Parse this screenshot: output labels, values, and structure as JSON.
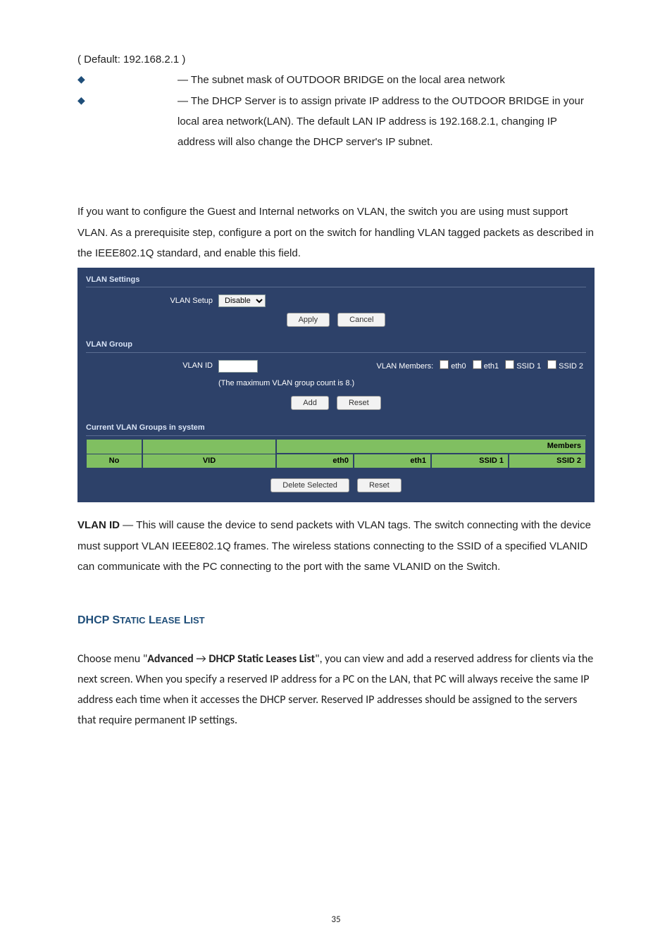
{
  "top": {
    "default_ip": "( Default: 192.168.2.1 )",
    "subnet_text": "— The subnet mask of OUTDOOR BRIDGE on the local area network",
    "dhcp_text": "— The DHCP Server is to assign private IP address to the OUTDOOR BRIDGE in your local area network(LAN). The default LAN IP address is 192.168.2.1, changing IP address will also change the DHCP server's IP subnet."
  },
  "intro": "If you want to configure the Guest and Internal networks on VLAN, the switch you are using must support VLAN. As a prerequisite step, configure a port on the switch for handling VLAN tagged packets as described in the IEEE802.1Q standard, and enable this field.",
  "panel": {
    "sec1": "VLAN Settings",
    "setup_lbl": "VLAN Setup",
    "setup_val": "Disable",
    "apply": "Apply",
    "cancel": "Cancel",
    "sec2": "VLAN Group",
    "vlan_id_lbl": "VLAN ID",
    "members_lbl": "VLAN Members:",
    "m_eth0": "eth0",
    "m_eth1": "eth1",
    "m_ssid1": "SSID 1",
    "m_ssid2": "SSID 2",
    "max_note": "(The maximum VLAN group count is 8.)",
    "add": "Add",
    "reset": "Reset",
    "sec3": "Current VLAN Groups in system",
    "col_no": "No",
    "col_vid": "VID",
    "col_members": "Members",
    "col_eth0": "eth0",
    "col_eth1": "eth1",
    "col_ssid1": "SSID 1",
    "col_ssid2": "SSID 2",
    "del_sel": "Delete Selected",
    "reset2": "Reset"
  },
  "vlan_id_para": {
    "label": "VLAN ID",
    "text": " — This will cause the device to send packets with VLAN tags. The switch connecting with the device must support VLAN IEEE802.1Q frames. The wireless stations connecting to the SSID of a specified VLANID can communicate with the PC connecting to the port with the same VLANID on the Switch."
  },
  "h2": {
    "big1": "DHCP S",
    "sm1": "TATIC",
    "big2": " L",
    "sm2": "EASE",
    "big3": " L",
    "sm3": "IST"
  },
  "lease": {
    "prefix": "Choose menu \"",
    "adv": "Advanced",
    "arrow": "  →  ",
    "list": "DHCP Static Leases List",
    "suffix": "\", you can view and add a reserved address for clients via the next screen. When you specify a reserved IP address for a PC on the LAN, that PC will always receive the same IP address each time when it accesses the DHCP server. Reserved IP addresses should be assigned to the servers that require permanent IP settings."
  },
  "page_number": "35"
}
